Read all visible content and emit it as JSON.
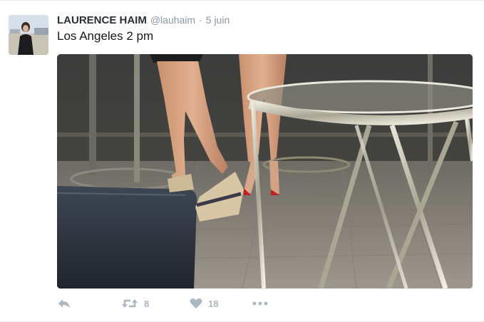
{
  "tweet": {
    "author_name": "LAURENCE HAIM",
    "handle": "@lauhaim",
    "separator": "·",
    "time": "5 juin",
    "text": "Los Angeles 2 pm"
  },
  "actions": {
    "retweet_count": "8",
    "like_count": "18"
  },
  "icons": {
    "reply": "reply-icon",
    "retweet": "retweet-icon",
    "like": "heart-icon",
    "more": "more-icon"
  },
  "colors": {
    "name": "#292f33",
    "meta": "#8899a6",
    "text": "#14171a",
    "action_icon": "#aab8c2"
  }
}
